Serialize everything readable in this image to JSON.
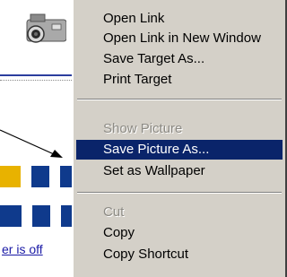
{
  "menu": {
    "items": [
      {
        "label": "Open Link",
        "disabled": false
      },
      {
        "label": "Open Link in New Window",
        "disabled": false
      },
      {
        "label": "Save Target As...",
        "disabled": false
      },
      {
        "label": "Print Target",
        "disabled": false
      },
      {
        "label": "Show Picture",
        "disabled": true
      },
      {
        "label": "Save Picture As...",
        "disabled": false,
        "selected": true
      },
      {
        "label": "Set as Wallpaper",
        "disabled": false
      },
      {
        "label": "Cut",
        "disabled": true
      },
      {
        "label": "Copy",
        "disabled": false
      },
      {
        "label": "Copy Shortcut",
        "disabled": false
      }
    ]
  },
  "page": {
    "link_fragment": "er is off"
  },
  "colors": {
    "menu_bg": "#d4d0c8",
    "highlight": "#0a246a",
    "disabled_text": "#8c8a84",
    "link": "#1a1aa6"
  }
}
